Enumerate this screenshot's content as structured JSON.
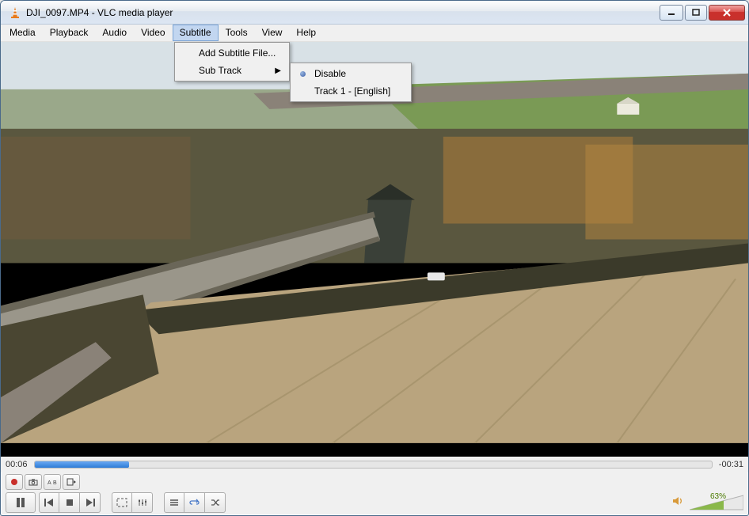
{
  "titlebar": {
    "title": "DJI_0097.MP4 - VLC media player"
  },
  "menubar": {
    "items": [
      "Media",
      "Playback",
      "Audio",
      "Video",
      "Subtitle",
      "Tools",
      "View",
      "Help"
    ],
    "active_index": 4
  },
  "subtitle_menu": {
    "add_file": "Add Subtitle File...",
    "sub_track": "Sub Track"
  },
  "subtrack_submenu": {
    "disable": "Disable",
    "track1": "Track 1 - [English]"
  },
  "playback": {
    "elapsed": "00:06",
    "remaining": "-00:31",
    "progress_percent": 14
  },
  "volume": {
    "percent_label": "63%",
    "level": 63
  },
  "icons": {
    "minimize": "minimize",
    "maximize": "maximize",
    "close": "close"
  }
}
